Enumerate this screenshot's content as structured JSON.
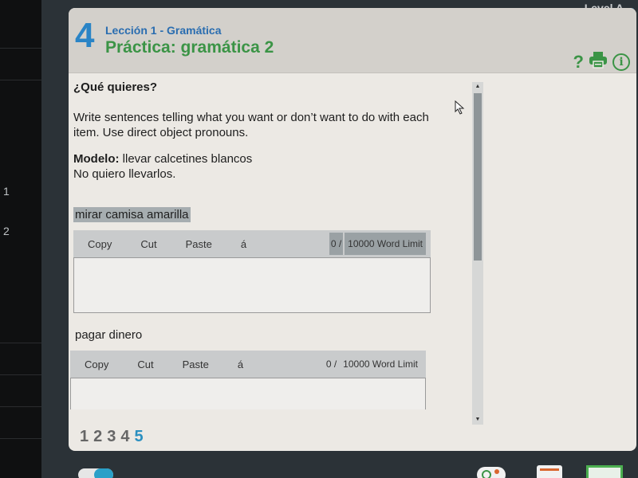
{
  "topbar": {
    "level_label": "Level A",
    "level_caret": "▼"
  },
  "left_rail": {
    "items": [
      "1",
      "2"
    ]
  },
  "header": {
    "unit_number": "4",
    "lesson": "Lección 1 - Gramática",
    "title": "Práctica: gramática 2",
    "help_icon": "?",
    "info_icon": "i"
  },
  "question": {
    "title": "¿Qué quieres?",
    "instructions": "Write sentences telling what you want or don’t want to do with each item. Use direct object pronouns.",
    "modelo_label": "Modelo:",
    "modelo_prompt": "llevar calcetines blancos",
    "modelo_answer": "No quiero llevarlos."
  },
  "items": [
    {
      "label": "mirar camisa amarilla",
      "toolbar": [
        "Copy",
        "Cut",
        "Paste",
        "á"
      ],
      "word_count": "0 /",
      "word_limit": "10000 Word Limit",
      "value": ""
    },
    {
      "label": "pagar dinero",
      "toolbar": [
        "Copy",
        "Cut",
        "Paste",
        "á"
      ],
      "word_count": "0 /",
      "word_limit": "10000 Word Limit",
      "value": ""
    }
  ],
  "pagination": {
    "pages": [
      "1",
      "2",
      "3",
      "4",
      "5"
    ],
    "current": "5"
  },
  "colors": {
    "unit_blue": "#2a84c6",
    "title_green": "#3b9446",
    "active_page": "#2a8fc0"
  }
}
